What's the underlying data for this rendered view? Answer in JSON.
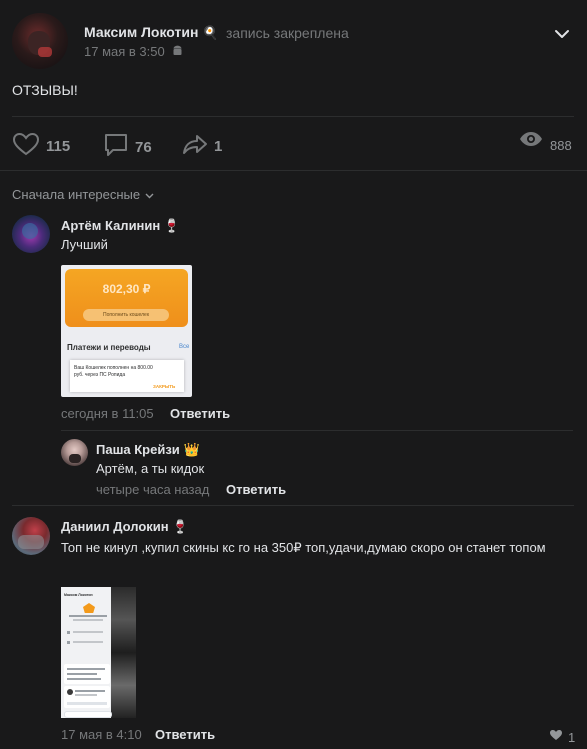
{
  "post": {
    "author": "Максим Локотин",
    "author_emoji": "🍳",
    "pinned_label": "запись закреплена",
    "time": "17 мая в 3:50",
    "text": "ОТЗЫВЫ!",
    "likes": "115",
    "comments": "76",
    "shares": "1",
    "views": "888"
  },
  "sort_label": "Сначала интересные",
  "comments": [
    {
      "author": "Артём Калинин",
      "emoji": "🍷",
      "text": "Лучший",
      "time": "сегодня в 11:05",
      "reply_label": "Ответить",
      "attachment": {
        "amount": "802,30 ₽",
        "button": "Пополнить кошелек",
        "section": "Платежи и переводы",
        "section_link": "Все",
        "notice": "Ваш Кошелек пополнен на 800.00 руб. через ПС Ропида",
        "close": "ЗАКРЫТЬ"
      }
    },
    {
      "author": "Паша Крейзи",
      "emoji": "👑",
      "text": "Артём, а ты кидок",
      "time": "четыре часа назад",
      "reply_label": "Ответить"
    },
    {
      "author": "Даниил Долокин",
      "emoji": "🍷",
      "text": "Топ не кинул ,купил скины кс го на 350₽ топ,удачи,думаю скоро он станет топом",
      "time": "17 мая в 4:10",
      "reply_label": "Ответить",
      "likes": "1",
      "attachment": {
        "chat_name": "Максим Локотин"
      }
    }
  ],
  "colors": {
    "background": "#19191a",
    "text": "#e1e3e6",
    "muted": "#76787a",
    "orange": "#f39a1b"
  }
}
